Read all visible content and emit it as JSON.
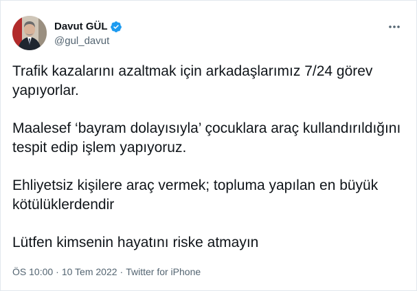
{
  "user": {
    "display_name": "Davut GÜL",
    "handle": "@gul_davut",
    "avatar_icon": "user-avatar",
    "verified_icon": "verified-badge-icon",
    "verified_color": "#1d9bf0"
  },
  "menu": {
    "icon": "more-options-icon"
  },
  "tweet": {
    "paragraphs": [
      "Trafik kazalarını azaltmak için arkadaşlarımız 7/24 görev yapıyorlar.",
      "Maalesef ‘bayram dolayısıyla’ çocuklara araç kullandırıldığını tespit edip işlem yapıyoruz.",
      "Ehliyetsiz kişilere araç vermek; topluma yapılan en büyük kötülüklerdendir",
      "Lütfen kimsenin hayatını riske atmayın"
    ]
  },
  "meta": {
    "time": "ÖS 10:00",
    "separator": "·",
    "date": "10 Tem 2022",
    "source": "Twitter for iPhone"
  }
}
